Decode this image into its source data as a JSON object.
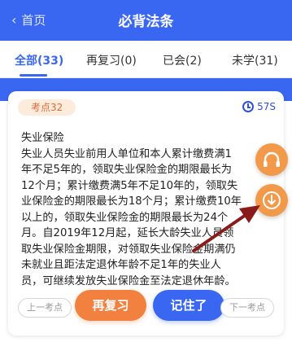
{
  "nav": {
    "back_label": "首页",
    "title": "必背法条"
  },
  "tabs": [
    {
      "label": "全部(33)",
      "active": true
    },
    {
      "label": "再复习(0)",
      "active": false
    },
    {
      "label": "已会(2)",
      "active": false
    },
    {
      "label": "未学(31)",
      "active": false
    }
  ],
  "card": {
    "chip_label": "考点32",
    "timer_value": "57S",
    "lines": [
      "失业保险",
      "失业人员失业前用人单位和本人累计缴费满1",
      "年不足5年的，领取失业保险金的期限最长为",
      "12个月；累计缴费满5年不足10年的，领取失",
      "业保险金的期限最长为18个月；累计缴费10年",
      "以上的，领取失业保险金的期限最长为24个",
      "月。自2019年12月起，延长大龄失业人员领",
      "取失业保险金期限，对领取失业保险金期满仍",
      "未就业且距法定退休年龄不足1年的失业人",
      "员，可继续发放失业保险金至法定退休年龄。"
    ],
    "prev_label": "上一考点",
    "review_label": "再复习",
    "known_label": "记住了",
    "next_label": "下一考点"
  },
  "floating": {
    "headset_icon": "headset-icon",
    "download_icon": "download-icon"
  },
  "colors": {
    "primary": "#3a67f2",
    "accent": "#f2813f",
    "arrow": "#8b1a1a"
  }
}
